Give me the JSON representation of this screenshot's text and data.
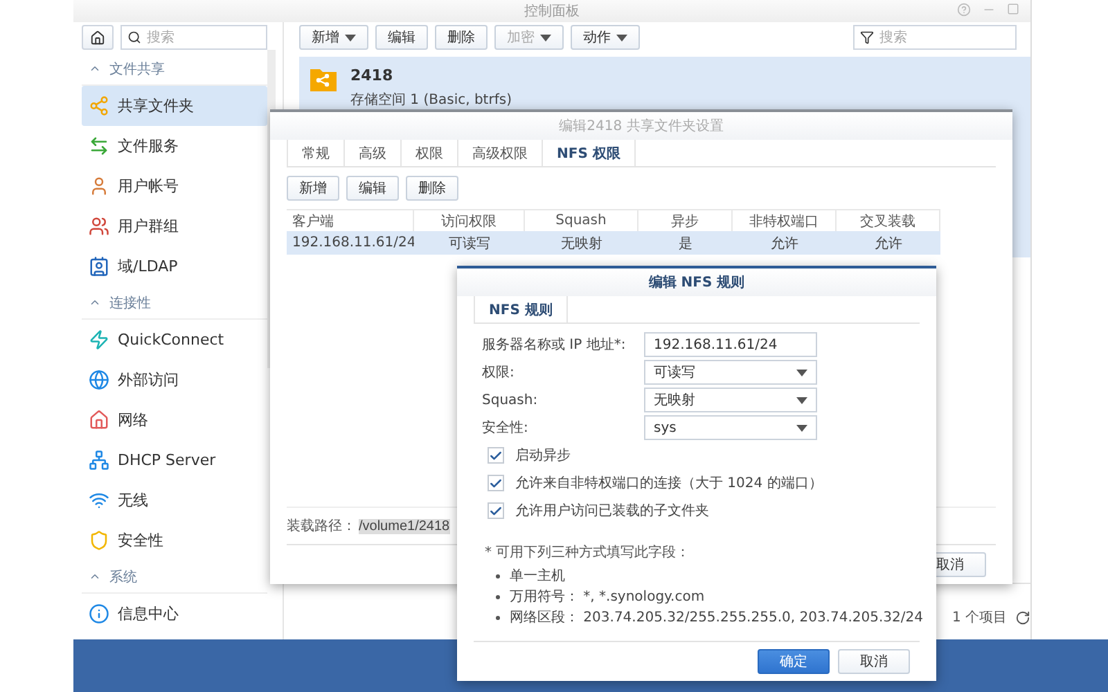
{
  "window": {
    "title": "控制面板"
  },
  "sidebar": {
    "search_placeholder": "搜索",
    "sections": [
      {
        "title": "文件共享",
        "expanded": true,
        "items": [
          {
            "label": "共享文件夹",
            "kind": "share",
            "selected": true
          },
          {
            "label": "文件服务",
            "kind": "service",
            "selected": false
          },
          {
            "label": "用户帐号",
            "kind": "user",
            "selected": false
          },
          {
            "label": "用户群组",
            "kind": "group",
            "selected": false
          },
          {
            "label": "域/LDAP",
            "kind": "ldap",
            "selected": false
          }
        ]
      },
      {
        "title": "连接性",
        "expanded": true,
        "items": [
          {
            "label": "QuickConnect",
            "kind": "quick",
            "selected": false
          },
          {
            "label": "外部访问",
            "kind": "globe",
            "selected": false
          },
          {
            "label": "网络",
            "kind": "home",
            "selected": false
          },
          {
            "label": "DHCP Server",
            "kind": "dhcp",
            "selected": false
          },
          {
            "label": "无线",
            "kind": "wifi",
            "selected": false
          },
          {
            "label": "安全性",
            "kind": "shield",
            "selected": false
          }
        ]
      },
      {
        "title": "系统",
        "expanded": true,
        "items": [
          {
            "label": "信息中心",
            "kind": "info",
            "selected": false
          }
        ]
      }
    ]
  },
  "toolbar": {
    "buttons": [
      {
        "label": "新增",
        "dropdown": true,
        "disabled": false
      },
      {
        "label": "编辑",
        "dropdown": false,
        "disabled": false
      },
      {
        "label": "删除",
        "dropdown": false,
        "disabled": false
      },
      {
        "label": "加密",
        "dropdown": true,
        "disabled": true
      },
      {
        "label": "动作",
        "dropdown": true,
        "disabled": false
      }
    ],
    "search_placeholder": "搜索"
  },
  "folders": [
    {
      "name": "2418",
      "volume": "存储空间 1 (Basic, btrfs)",
      "selected": true
    }
  ],
  "status": "1 个项目",
  "share_dialog": {
    "title": "编辑2418 共享文件夹设置",
    "tabs": [
      {
        "label": "常规",
        "selected": false
      },
      {
        "label": "高级",
        "selected": false
      },
      {
        "label": "权限",
        "selected": false
      },
      {
        "label": "高级权限",
        "selected": false
      },
      {
        "label": "NFS 权限",
        "selected": true
      }
    ],
    "buttons": [
      "新增",
      "编辑",
      "删除"
    ],
    "table": {
      "columns": [
        "客户端",
        "访问权限",
        "Squash",
        "异步",
        "非特权端口",
        "交叉装载"
      ],
      "rows": [
        {
          "cells": [
            "192.168.11.61/24",
            "可读写",
            "无映射",
            "是",
            "允许",
            "允许"
          ],
          "selected": true
        }
      ]
    },
    "mount_label": "装载路径：",
    "mount_path": "/volume1/2418",
    "footer_buttons": [
      "取消"
    ]
  },
  "nfs_dialog": {
    "title": "编辑 NFS 规则",
    "tabs": [
      {
        "label": "NFS 规则",
        "selected": true
      }
    ],
    "fields": [
      {
        "label": "服务器名称或 IP 地址*:",
        "value": "192.168.11.61/24",
        "kind": "text"
      },
      {
        "label": "权限:",
        "value": "可读写",
        "kind": "select"
      },
      {
        "label": "Squash:",
        "value": "无映射",
        "kind": "select"
      },
      {
        "label": "安全性:",
        "value": "sys",
        "kind": "select"
      }
    ],
    "checkboxes": [
      {
        "label": "启动异步",
        "checked": true
      },
      {
        "label": "允许来自非特权端口的连接（大于 1024 的端口）",
        "checked": true
      },
      {
        "label": "允许用户访问已装载的子文件夹",
        "checked": true
      }
    ],
    "note": "* 可用下列三种方式填写此字段：",
    "bullets": [
      "单一主机",
      "万用符号： *, *.synology.com",
      "网络区段： 203.74.205.32/255.255.255.0, 203.74.205.32/24"
    ],
    "buttons": [
      {
        "label": "确定",
        "primary": true
      },
      {
        "label": "取消",
        "primary": false
      }
    ]
  }
}
